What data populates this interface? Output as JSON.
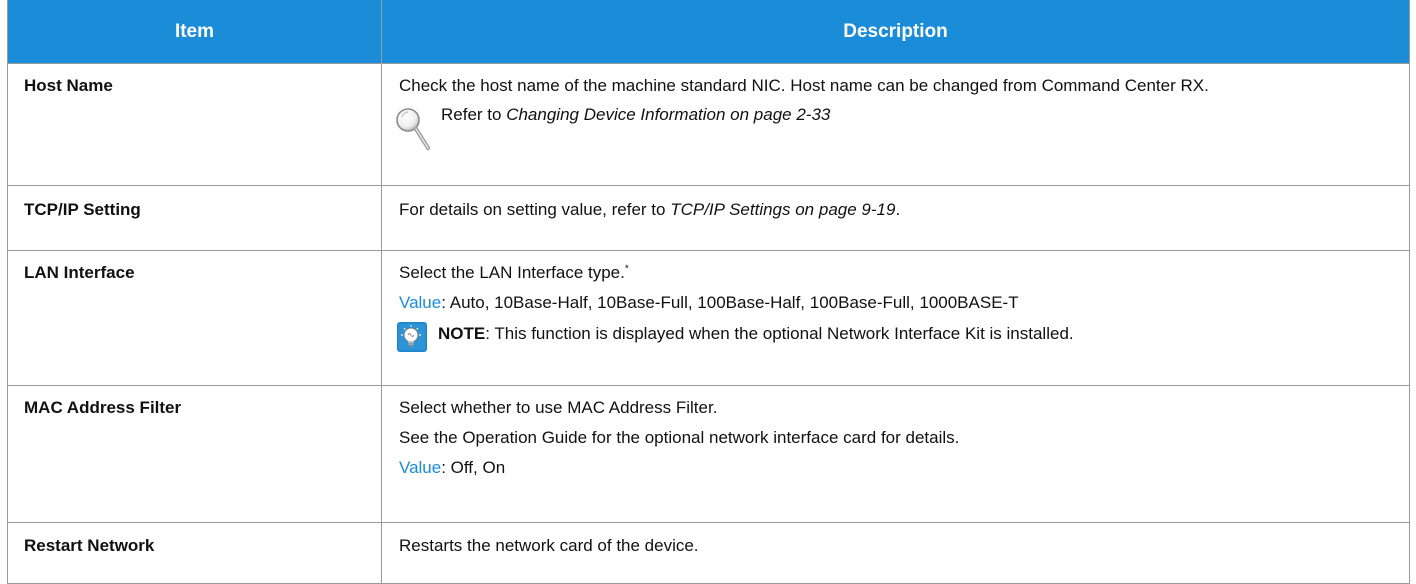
{
  "header": {
    "item": "Item",
    "description": "Description"
  },
  "rows": {
    "host_name": {
      "item": "Host Name",
      "desc": "Check the host name of the machine standard NIC. Host name can be changed from Command Center RX.",
      "refer_prefix": "Refer to ",
      "refer_link": "Changing Device Information on page 2-33"
    },
    "tcpip": {
      "item": "TCP/IP Setting",
      "desc_prefix": "For details on setting value, refer to ",
      "desc_link": "TCP/IP Settings on page 9-19",
      "desc_suffix": "."
    },
    "lan": {
      "item": "LAN Interface",
      "desc": "Select the LAN Interface type.",
      "footnote": "*",
      "value_label": "Value",
      "value_text": ": Auto, 10Base-Half, 10Base-Full, 100Base-Half, 100Base-Full, 1000BASE-T",
      "note_label": "NOTE",
      "note_text": ": This function is displayed when the optional Network Interface Kit is installed."
    },
    "mac": {
      "item": "MAC Address Filter",
      "desc": "Select whether to use MAC Address Filter.",
      "desc2": "See the Operation Guide for the optional network interface card for details.",
      "value_label": "Value",
      "value_text": ": Off, On"
    },
    "restart": {
      "item": "Restart Network",
      "desc": "Restarts the network card of the device."
    }
  },
  "colors": {
    "header_bg": "#1a8cd8",
    "header_text": "#ffffff",
    "value_label": "#1a8cd8",
    "border": "#9a9a9a"
  },
  "icons": {
    "reference": "magnifier-icon",
    "note": "lightbulb-note-icon"
  }
}
